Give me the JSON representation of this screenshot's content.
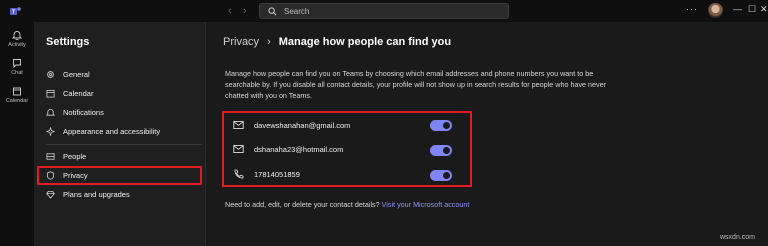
{
  "titlebar": {
    "search_placeholder": "Search",
    "more": "···",
    "minimize": "—",
    "maximize": "☐",
    "close": "✕"
  },
  "rail": {
    "items": [
      {
        "label": "Activity",
        "icon": "bell-icon"
      },
      {
        "label": "Chat",
        "icon": "chat-icon"
      },
      {
        "label": "Calendar",
        "icon": "calendar-icon"
      }
    ]
  },
  "settings": {
    "title": "Settings",
    "items": [
      {
        "label": "General",
        "icon": "gear-icon"
      },
      {
        "label": "Calendar",
        "icon": "calendar-icon"
      },
      {
        "label": "Notifications",
        "icon": "bell-icon"
      },
      {
        "label": "Appearance and accessibility",
        "icon": "sparkle-icon"
      },
      {
        "label": "People",
        "icon": "people-icon"
      },
      {
        "label": "Privacy",
        "icon": "shield-icon"
      },
      {
        "label": "Plans and upgrades",
        "icon": "diamond-icon"
      }
    ],
    "selected": "Privacy"
  },
  "main": {
    "breadcrumb_parent": "Privacy",
    "breadcrumb_sep": "›",
    "breadcrumb_current": "Manage how people can find you",
    "description": "Manage how people can find you on Teams by choosing which email addresses and phone numbers you want to be searchable by. If you disable all contact details, your profile will not show up in search results for people who have never chatted with you on Teams.",
    "contacts": [
      {
        "value": "davewshanahan@gmail.com",
        "icon": "mail-icon",
        "enabled": true
      },
      {
        "value": "dshanaha23@hotmail.com",
        "icon": "mail-icon",
        "enabled": true
      },
      {
        "value": "17814051859",
        "icon": "phone-icon",
        "enabled": true
      }
    ],
    "footer_question": "Need to add, edit, or delete your contact details?",
    "footer_link": "Visit your Microsoft account"
  },
  "colors": {
    "accent": "#7f85f5",
    "highlight": "#e31b23",
    "link": "#8b94f8"
  },
  "watermark": "wsxdn.com"
}
